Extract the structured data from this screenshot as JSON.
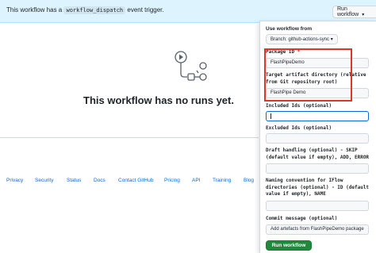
{
  "banner": {
    "text_before": "This workflow has a",
    "code": "workflow_dispatch",
    "text_after": "event trigger.",
    "run_button": "Run workflow"
  },
  "empty_state": {
    "title": "This workflow has no runs yet."
  },
  "footer": {
    "links": [
      "Privacy",
      "Security",
      "Status",
      "Docs",
      "Contact GitHub",
      "Pricing",
      "API",
      "Training",
      "Blog"
    ]
  },
  "panel": {
    "use_workflow_from": "Use workflow from",
    "branch": "Branch: github-actions-sync",
    "fields": [
      {
        "label": "Package ID",
        "required": true,
        "value": "FlashPipeDemo"
      },
      {
        "label": "Target artifact directory (relative from Git repository root)",
        "required": false,
        "value": "FlashPipe Demo"
      },
      {
        "label": "Included Ids (optional)",
        "required": false,
        "value": ""
      },
      {
        "label": "Excluded Ids (optional)",
        "required": false,
        "value": ""
      },
      {
        "label": "Draft handling (optional) - SKIP (default value if empty), ADD, ERROR",
        "required": false,
        "value": ""
      },
      {
        "label": "Naming convention for IFlow directories (optional) - ID (default value if empty), NAME",
        "required": false,
        "value": ""
      },
      {
        "label": "Commit message (optional)",
        "required": false,
        "value": "Add artefacts from FlashPipeDemo package"
      }
    ],
    "run_button": "Run workflow"
  },
  "colors": {
    "banner_bg": "#ddf4ff",
    "link": "#0969da",
    "run_button": "#1f883d",
    "highlight": "#e0352b",
    "focus": "#0969da"
  }
}
